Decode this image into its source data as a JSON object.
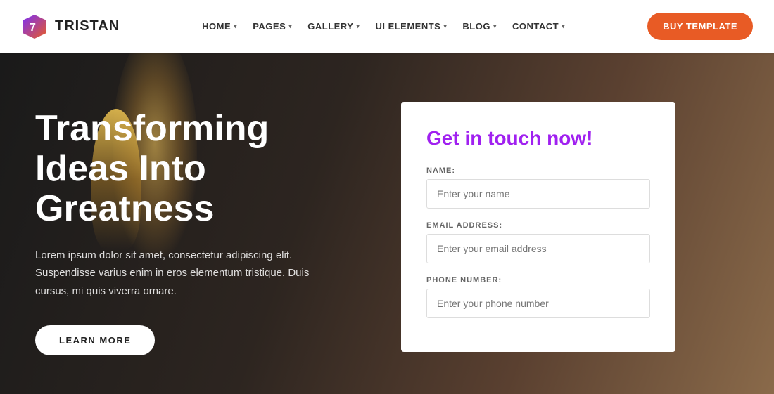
{
  "navbar": {
    "logo_text": "TRISTAN",
    "nav_items": [
      {
        "label": "HOME",
        "has_dropdown": true
      },
      {
        "label": "PAGES",
        "has_dropdown": true
      },
      {
        "label": "GALLERY",
        "has_dropdown": true
      },
      {
        "label": "UI ELEMENTS",
        "has_dropdown": true
      },
      {
        "label": "BLOG",
        "has_dropdown": true
      },
      {
        "label": "CONTACT",
        "has_dropdown": true
      }
    ],
    "buy_button": "BUY TEMPLATE"
  },
  "hero": {
    "title": "Transforming Ideas Into Greatness",
    "description": "Lorem ipsum dolor sit amet, consectetur adipiscing elit. Suspendisse varius enim in eros elementum tristique. Duis cursus, mi quis viverra ornare.",
    "learn_more": "LEARN MORE"
  },
  "form": {
    "title": "Get in touch now!",
    "fields": [
      {
        "label": "NAME:",
        "placeholder": "Enter your name",
        "type": "text",
        "id": "name"
      },
      {
        "label": "EMAIL ADDRESS:",
        "placeholder": "Enter your email address",
        "type": "email",
        "id": "email"
      },
      {
        "label": "PHONE NUMBER:",
        "placeholder": "Enter your phone number",
        "type": "tel",
        "id": "phone"
      }
    ]
  },
  "colors": {
    "accent_orange": "#e85b25",
    "accent_purple": "#a020f0",
    "nav_bg": "#ffffff",
    "hero_dark": "#1a1a1a"
  }
}
